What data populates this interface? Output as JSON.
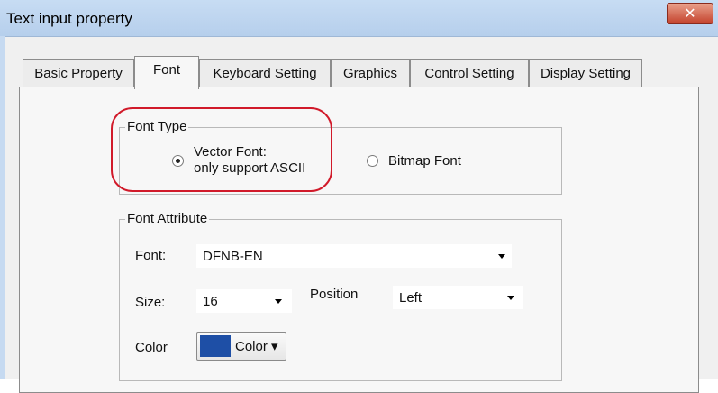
{
  "window": {
    "title": "Text input property",
    "close_label": "✕"
  },
  "tabs": [
    {
      "label": "Basic Property"
    },
    {
      "label": "Font"
    },
    {
      "label": "Keyboard Setting"
    },
    {
      "label": "Graphics"
    },
    {
      "label": "Control Setting"
    },
    {
      "label": "Display Setting"
    }
  ],
  "active_tab": "Font",
  "font_type": {
    "legend": "Font Type",
    "vector_label_line1": "Vector Font:",
    "vector_label_line2": "only support ASCII",
    "bitmap_label": "Bitmap Font",
    "selected": "vector"
  },
  "font_attribute": {
    "legend": "Font Attribute",
    "font_label": "Font:",
    "font_value": "DFNB-EN",
    "size_label": "Size:",
    "size_value": "16",
    "position_label": "Position",
    "position_value": "Left",
    "color_label": "Color",
    "color_button_label": "Color ▾",
    "color_value": "#1e4fa6"
  },
  "colors": {
    "highlight": "#d11a2a",
    "titlebar": "#c7dcf3"
  }
}
